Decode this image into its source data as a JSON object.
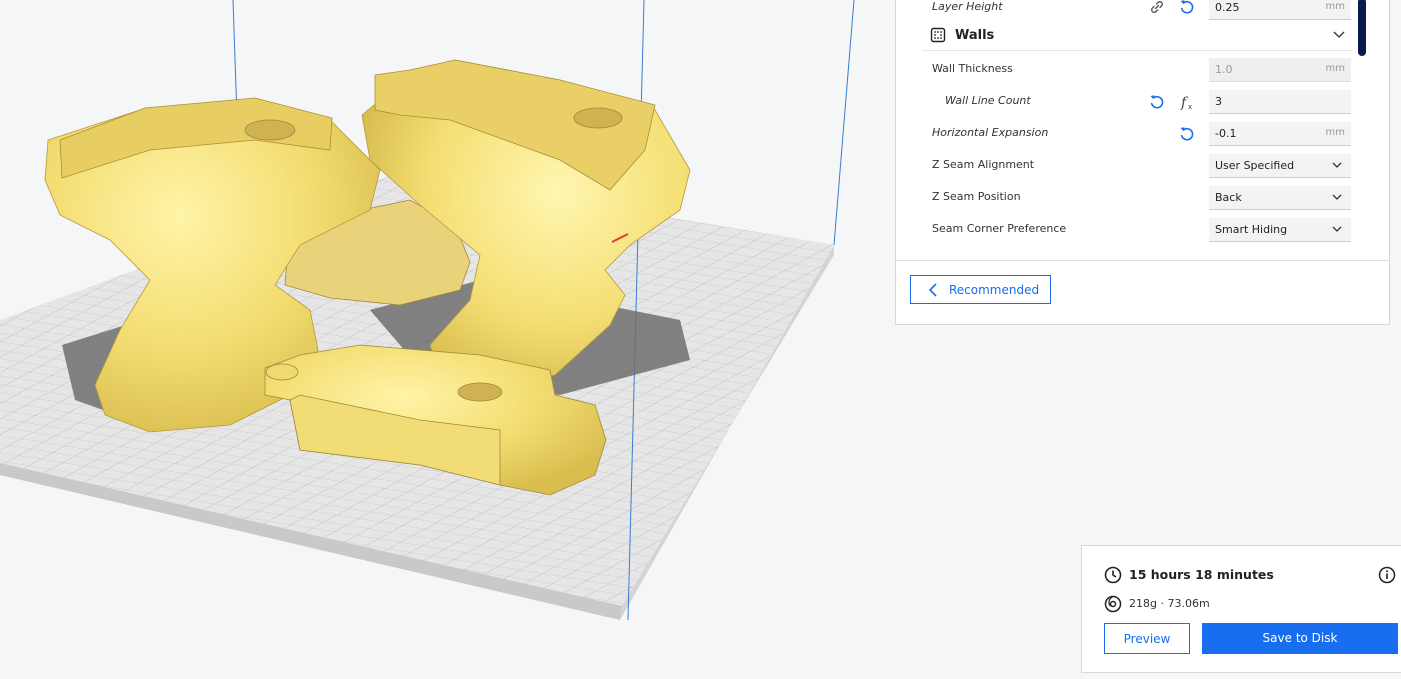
{
  "settings": {
    "layer_height": {
      "label": "Layer Height",
      "value": "0.25",
      "unit": "mm"
    },
    "walls_section": {
      "title": "Walls"
    },
    "wall_thickness": {
      "label": "Wall Thickness",
      "value": "1.0",
      "unit": "mm"
    },
    "wall_line_count": {
      "label": "Wall Line Count",
      "value": "3"
    },
    "horizontal_expansion": {
      "label": "Horizontal Expansion",
      "value": "-0.1",
      "unit": "mm"
    },
    "z_seam_alignment": {
      "label": "Z Seam Alignment",
      "value": "User Specified"
    },
    "z_seam_position": {
      "label": "Z Seam Position",
      "value": "Back"
    },
    "seam_corner_preference": {
      "label": "Seam Corner Preference",
      "value": "Smart Hiding"
    },
    "recommended_label": "Recommended"
  },
  "summary": {
    "print_time": "15 hours 18 minutes",
    "material": "218g · 73.06m",
    "preview_label": "Preview",
    "save_label": "Save to Disk"
  },
  "colors": {
    "accent": "#196ef0",
    "model": "#f7e47e",
    "build_plate": "#e4e4e4",
    "grid": "#c2c2c2",
    "volume_edges": "#3a7bd5"
  },
  "icons": [
    "link-icon",
    "reset-icon",
    "function-icon",
    "walls-icon",
    "chevron-down-icon",
    "chevron-left-icon",
    "clock-icon",
    "info-icon",
    "spool-icon"
  ]
}
